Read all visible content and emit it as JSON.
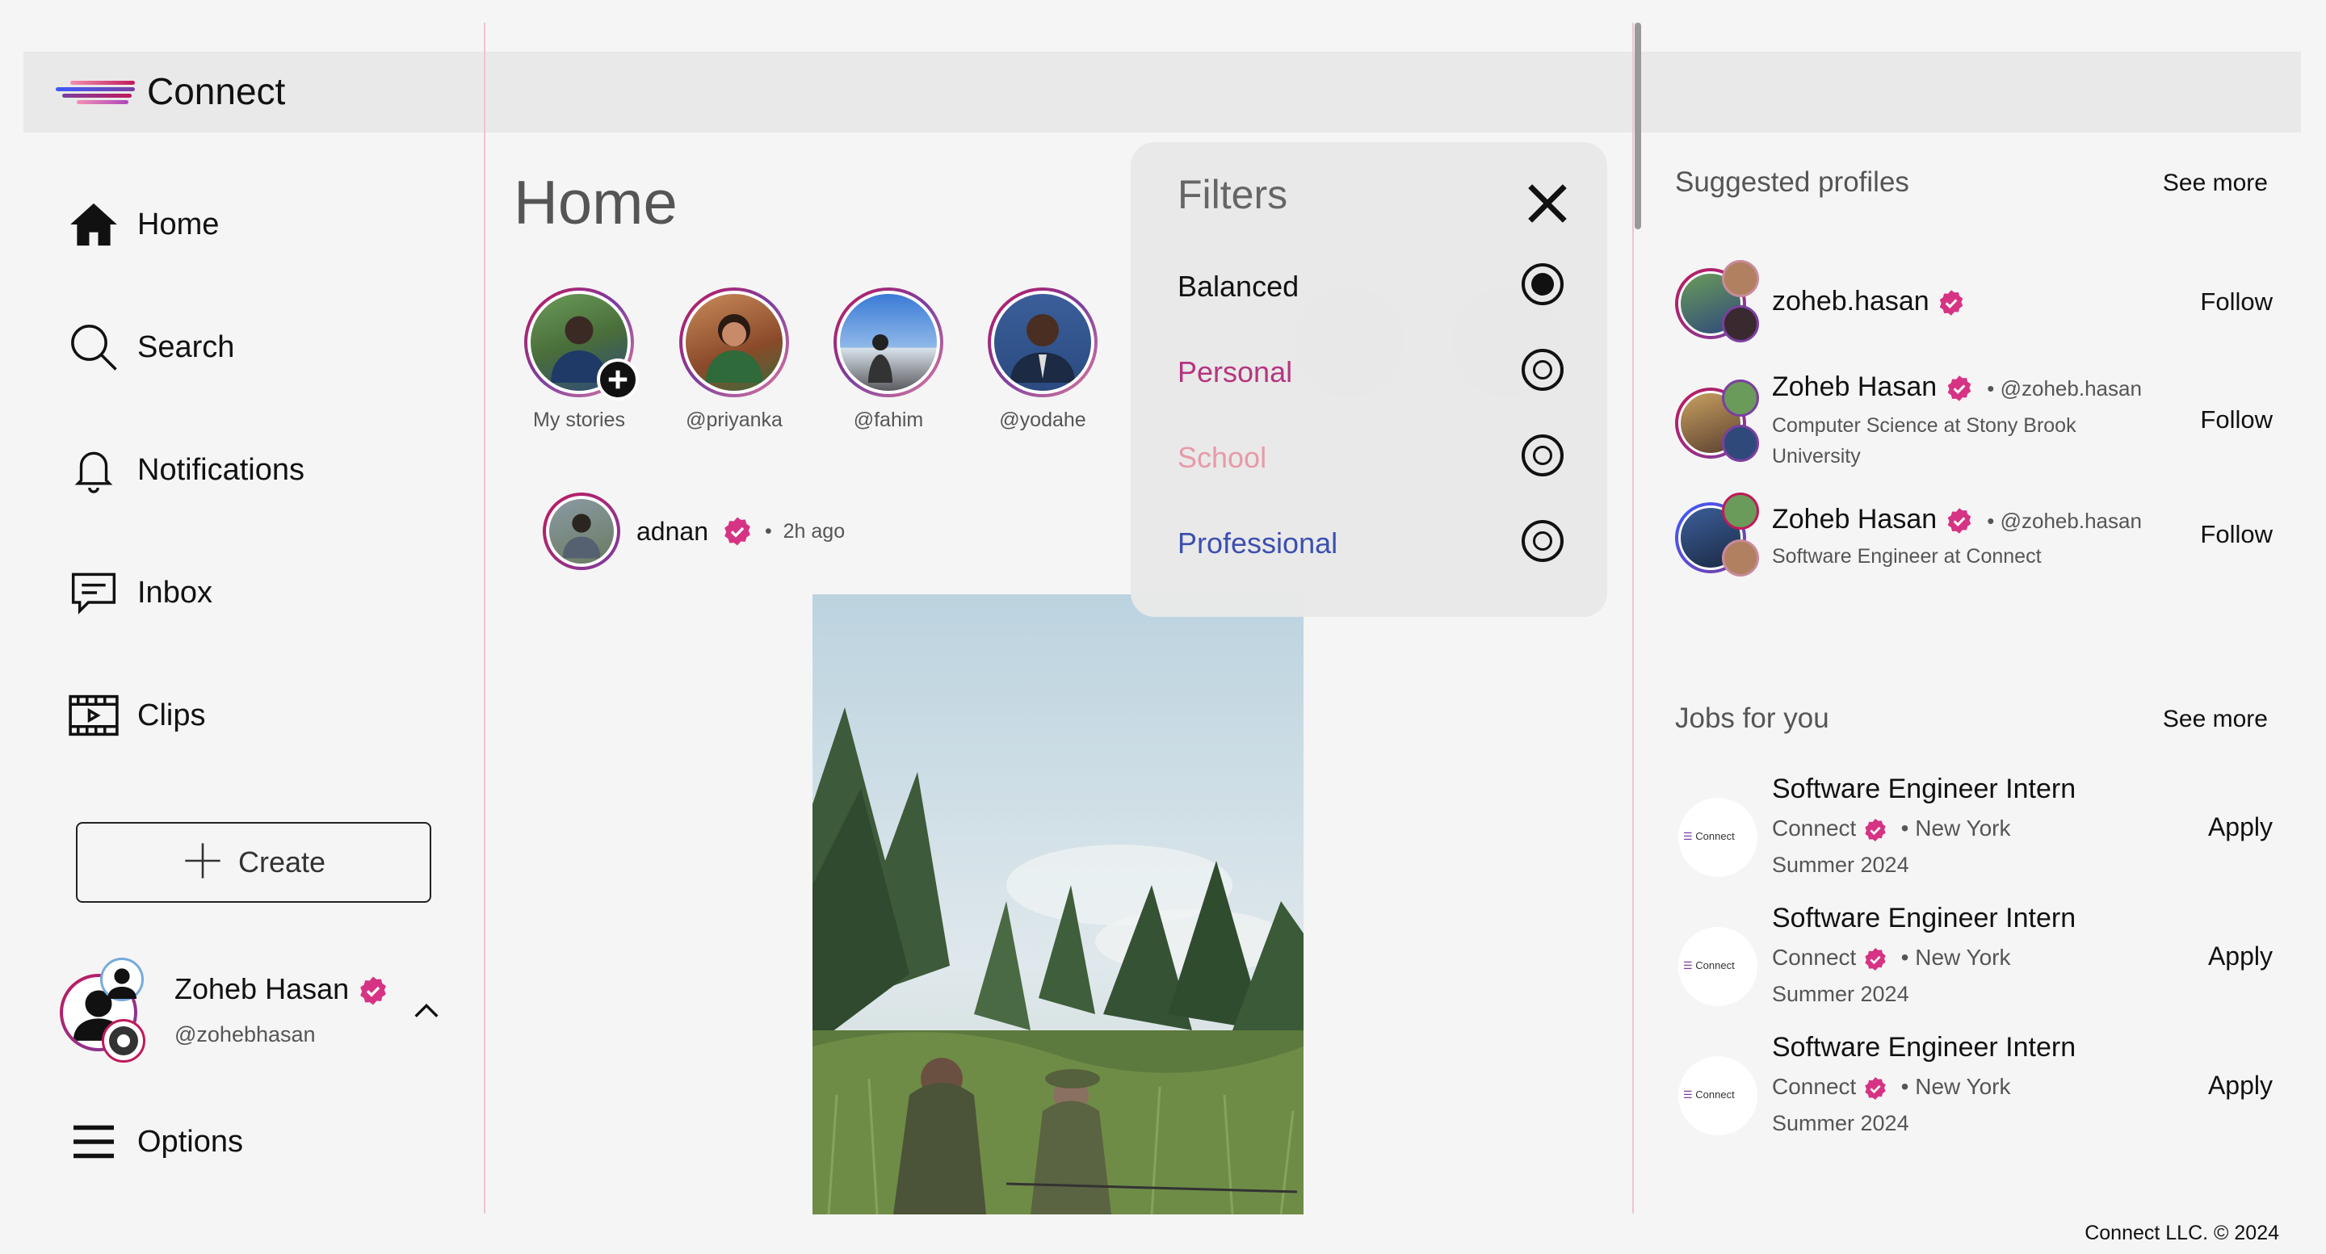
{
  "app": {
    "brand": "Connect",
    "brand_colors": [
      "#c2185b",
      "#7b3fa0",
      "#3d5afe",
      "#f48fb1"
    ]
  },
  "nav": {
    "items": [
      {
        "label": "Home",
        "icon": "home-icon"
      },
      {
        "label": "Search",
        "icon": "search-icon"
      },
      {
        "label": "Notifications",
        "icon": "bell-icon"
      },
      {
        "label": "Inbox",
        "icon": "inbox-icon"
      },
      {
        "label": "Clips",
        "icon": "clips-icon"
      }
    ],
    "create_label": "Create",
    "options_label": "Options"
  },
  "current_user": {
    "name": "Zoheb Hasan",
    "handle": "@zohebhasan"
  },
  "main": {
    "title": "Home",
    "stories": [
      {
        "caption": "My stories"
      },
      {
        "caption": "@priyanka"
      },
      {
        "caption": "@fahim"
      },
      {
        "caption": "@yodahe"
      }
    ],
    "post": {
      "author": "adnan",
      "time": "2h ago"
    }
  },
  "filters": {
    "title": "Filters",
    "options": [
      {
        "label": "Balanced",
        "selected": true,
        "color": "#111111"
      },
      {
        "label": "Personal",
        "selected": false,
        "color": "#b5357f"
      },
      {
        "label": "School",
        "selected": false,
        "color": "#e89aa8"
      },
      {
        "label": "Professional",
        "selected": false,
        "color": "#3d4fb0"
      }
    ]
  },
  "suggested": {
    "title": "Suggested profiles",
    "see_more": "See more",
    "profiles": [
      {
        "name": "zoheb.hasan",
        "handle": "",
        "line1": "",
        "line2": "",
        "action": "Follow"
      },
      {
        "name": "Zoheb Hasan",
        "handle": "@zoheb.hasan",
        "line1": "Computer Science at Stony Brook",
        "line2": "University",
        "action": "Follow"
      },
      {
        "name": "Zoheb Hasan",
        "handle": "@zoheb.hasan",
        "line1": "Software Engineer at Connect",
        "line2": "",
        "action": "Follow"
      }
    ]
  },
  "jobs": {
    "title": "Jobs for you",
    "see_more": "See more",
    "items": [
      {
        "title": "Software Engineer Intern",
        "company": "Connect",
        "location": "New York",
        "term": "Summer 2024",
        "action": "Apply",
        "logo_text": "Connect"
      },
      {
        "title": "Software Engineer Intern",
        "company": "Connect",
        "location": "New York",
        "term": "Summer 2024",
        "action": "Apply",
        "logo_text": "Connect"
      },
      {
        "title": "Software Engineer Intern",
        "company": "Connect",
        "location": "New York",
        "term": "Summer 2024",
        "action": "Apply",
        "logo_text": "Connect"
      }
    ]
  },
  "footer": "Connect LLC. © 2024",
  "verified_color": "#d63384"
}
